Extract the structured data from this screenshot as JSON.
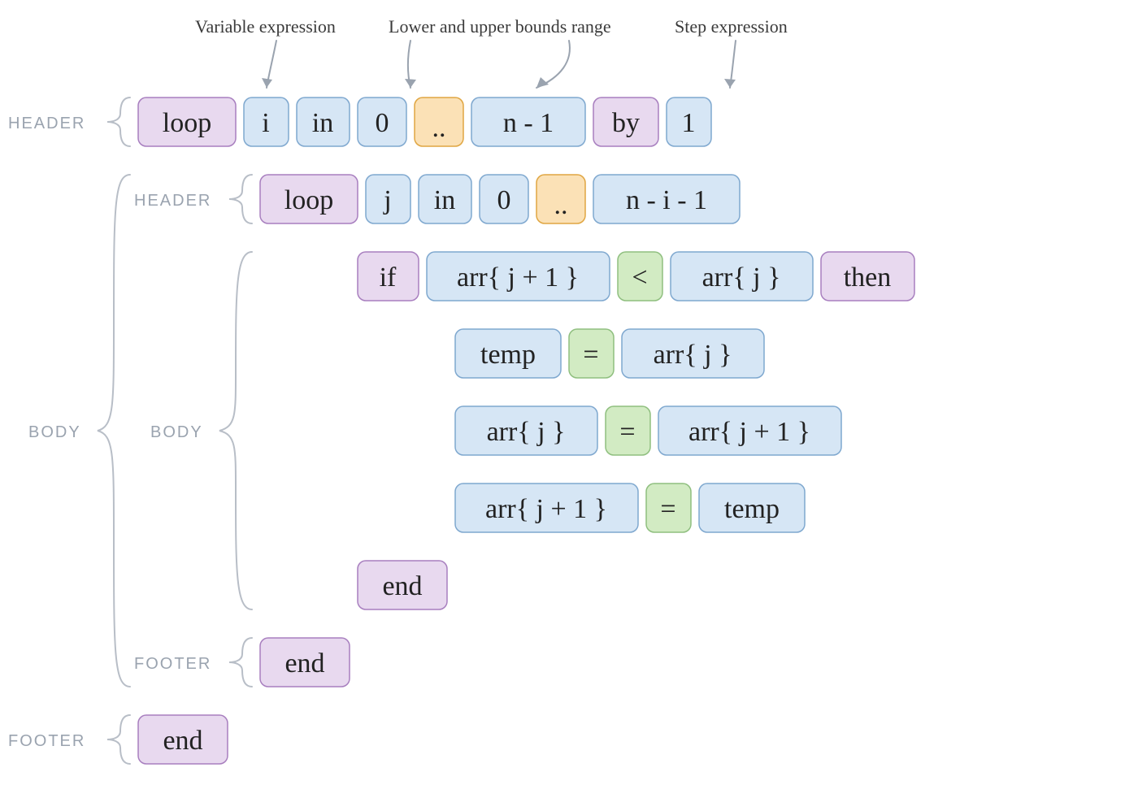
{
  "annotations": {
    "var_expr": "Variable expression",
    "bounds": "Lower and upper bounds range",
    "step": "Step expression"
  },
  "labels": {
    "header": "HEADER",
    "body": "BODY",
    "footer": "FOOTER"
  },
  "code": {
    "r1": {
      "loop": "loop",
      "i": "i",
      "in": "in",
      "zero": "0",
      "dots": "..",
      "upper": "n - 1",
      "by": "by",
      "one": "1"
    },
    "r2": {
      "loop": "loop",
      "j": "j",
      "in": "in",
      "zero": "0",
      "dots": "..",
      "upper": "n - i - 1"
    },
    "r3": {
      "if": "if",
      "a": "arr{ j + 1 }",
      "lt": "<",
      "b": "arr{ j }",
      "then": "then"
    },
    "r4": {
      "a": "temp",
      "eq": "=",
      "b": "arr{ j }"
    },
    "r5": {
      "a": "arr{ j }",
      "eq": "=",
      "b": "arr{ j + 1 }"
    },
    "r6": {
      "a": "arr{ j + 1 }",
      "eq": "=",
      "b": "temp"
    },
    "r7": {
      "end": "end"
    },
    "r8": {
      "end": "end"
    },
    "r9": {
      "end": "end"
    }
  }
}
